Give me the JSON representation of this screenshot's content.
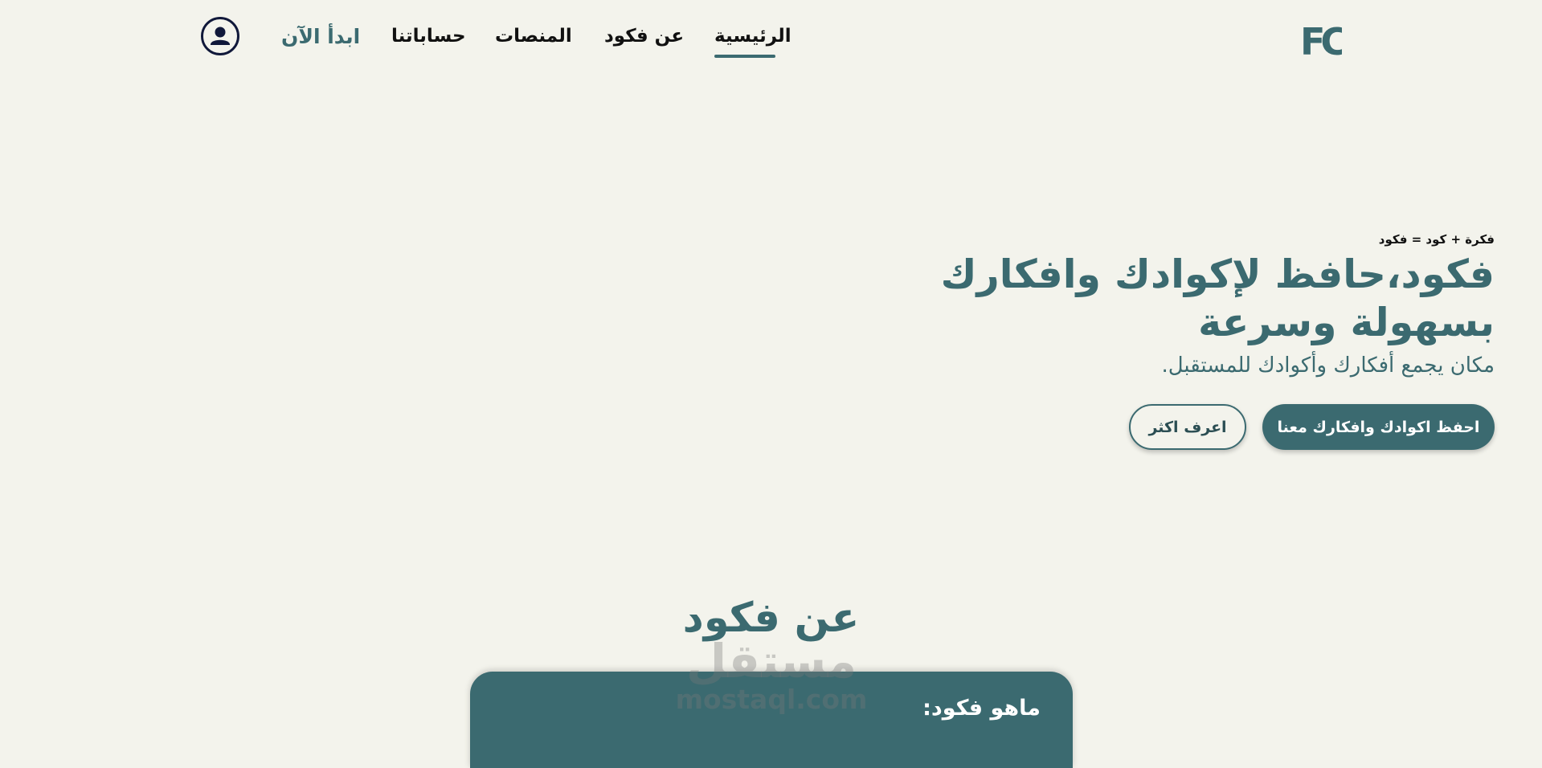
{
  "brand": {
    "logo_text": "FC",
    "primary_color": "#3b6a70",
    "background_color": "#f3f3ec"
  },
  "nav": {
    "home": "الرئيسية",
    "about": "عن فكود",
    "platforms": "المنصات",
    "accounts": "حساباتنا",
    "start": "ابدأ الآن",
    "avatar_icon": "user-circle-icon"
  },
  "hero": {
    "tagline": "فكرة + كود = فكود",
    "title": "فكود،حافظ لإكوادك وافكارك بسهولة وسرعة",
    "subtitle": "مكان يجمع أفكارك وأكوادك للمستقبل.",
    "primary_button": "احفظ اكوادك وافكارك معنا",
    "secondary_button": "اعرف اكثر"
  },
  "about": {
    "heading": "عن فكود",
    "card_title": "ماهو فكود:"
  },
  "watermark": {
    "arabic": "مستقل",
    "latin": "mostaql.com"
  }
}
